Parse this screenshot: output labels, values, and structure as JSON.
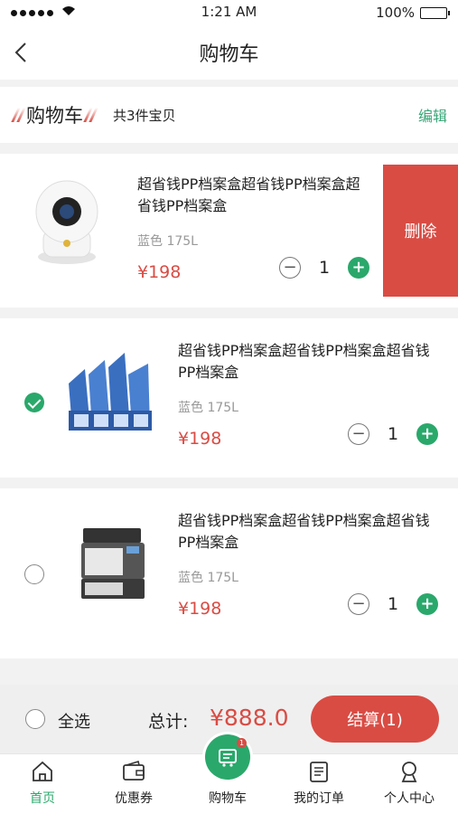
{
  "status_bar": {
    "time": "1:21 AM",
    "battery": "100%"
  },
  "nav": {
    "title": "购物车"
  },
  "header": {
    "title": "购物车",
    "count": "共3件宝贝",
    "edit": "编辑"
  },
  "items": [
    {
      "title": "超省钱PP档案盒超省钱PP档案盒超省钱PP档案盒",
      "spec": "蓝色 175L",
      "price": "¥198",
      "qty": "1",
      "selected": false,
      "delete_label": "删除"
    },
    {
      "title": "超省钱PP档案盒超省钱PP档案盒超省钱PP档案盒",
      "spec": "蓝色 175L",
      "price": "¥198",
      "qty": "1",
      "selected": true
    },
    {
      "title": "超省钱PP档案盒超省钱PP档案盒超省钱PP档案盒",
      "spec": "蓝色 175L",
      "price": "¥198",
      "qty": "1",
      "selected": false
    }
  ],
  "checkout": {
    "select_all": "全选",
    "total_label": "总计:",
    "total_value": "¥888.0",
    "button": "结算(1)"
  },
  "tabs": [
    {
      "label": "首页",
      "icon": "home-icon",
      "active": true
    },
    {
      "label": "优惠券",
      "icon": "wallet-icon",
      "active": false
    },
    {
      "label": "购物车",
      "icon": "cart-icon",
      "active": false,
      "badge": "1"
    },
    {
      "label": "我的订单",
      "icon": "order-icon",
      "active": false
    },
    {
      "label": "个人中心",
      "icon": "user-icon",
      "active": false
    }
  ],
  "colors": {
    "accent_green": "#2aa86b",
    "accent_red": "#d94c44"
  }
}
